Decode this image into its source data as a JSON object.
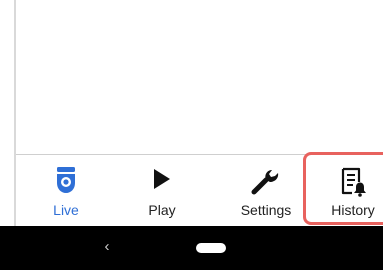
{
  "tabs": {
    "live": {
      "label": "Live",
      "icon": "security-camera-icon",
      "active": true
    },
    "play": {
      "label": "Play",
      "icon": "play-icon"
    },
    "settings": {
      "label": "Settings",
      "icon": "wrench-icon"
    },
    "history": {
      "label": "History",
      "icon": "notification-list-icon"
    }
  },
  "nav": {
    "back": "‹",
    "back_icon": "back-chevron-icon",
    "home_icon": "home-pill-icon"
  },
  "colors": {
    "accent": "#2f6fd6",
    "highlight": "#e8625e",
    "nav_bg": "#000000"
  }
}
